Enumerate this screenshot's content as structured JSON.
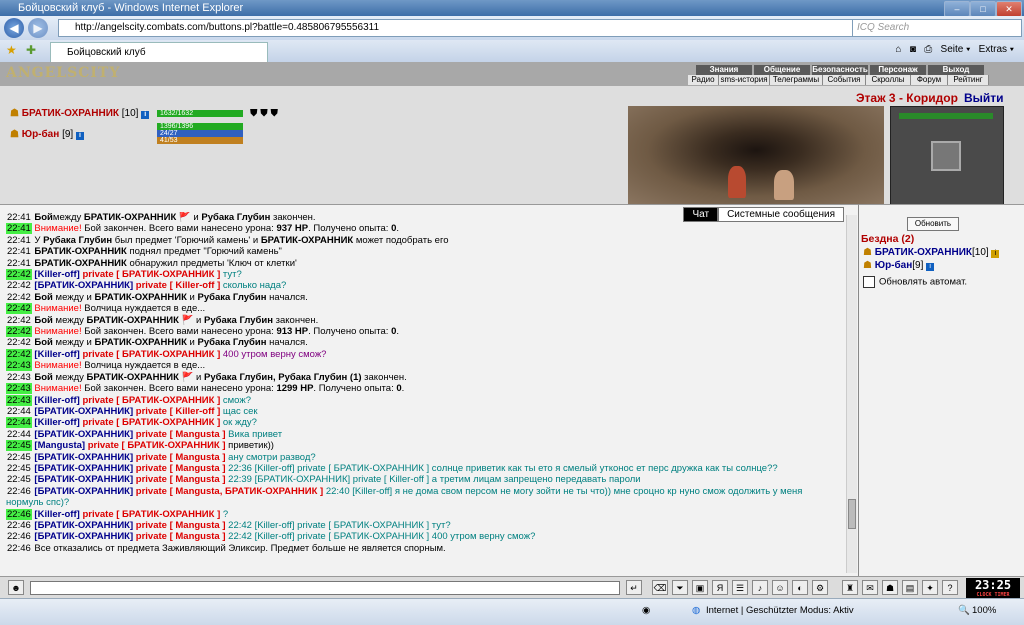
{
  "browser": {
    "title": "Бойцовский клуб - Windows Internet Explorer",
    "url": "http://angelscity.combats.com/buttons.pl?battle=0.485806795556311",
    "search_placeholder": "ICQ Search",
    "tab_title": "Бойцовский клуб",
    "tools": [
      "Seite ▾",
      "Extras ▾"
    ],
    "status_zone": "Internet | Geschützter Modus: Aktiv",
    "zoom": "100%"
  },
  "game": {
    "logo": "ANGELSCITY",
    "menu_top": [
      "Знания",
      "Общение",
      "Безопасность",
      "Персонаж",
      "Выход"
    ],
    "menu_bottom": [
      "Радио",
      "sms-история",
      "Телеграммы",
      "События",
      "Скроллы",
      "Форум",
      "Рейтинг"
    ],
    "floor_label": "Этаж 3 - Коридор",
    "exit_label": "Выйти",
    "players": [
      {
        "name": "БРАТИК-ОХРАННИК",
        "level": "[10]",
        "hp": "1632/1632",
        "hp_fraction": 1.0
      },
      {
        "name": "Юр-бан",
        "level": "[9]",
        "hp": "1396/1396",
        "mana": "24/27",
        "mana_fraction": 0.89,
        "stamina": "41/53",
        "stamina_fraction": 0.77,
        "hp_fraction": 1.0
      }
    ]
  },
  "chat": {
    "tabs": [
      "Чат",
      "Системные сообщения"
    ],
    "rows": [
      {
        "time": "22:41",
        "g": false,
        "segs": [
          [
            "b",
            "Бой"
          ],
          [
            "",
            "между "
          ],
          [
            "b",
            "БРАТИК-ОХРАННИК"
          ],
          [
            "",
            " 🚩 и "
          ],
          [
            "b",
            "Рубака Глубин"
          ],
          [
            "",
            " закончен."
          ]
        ]
      },
      {
        "time": "22:41",
        "g": true,
        "segs": [
          [
            "red",
            "Внимание!"
          ],
          [
            "",
            " Бой закончен. Всего вами нанесено урона: "
          ],
          [
            "b",
            "937 HP"
          ],
          [
            "",
            ". Получено опыта: "
          ],
          [
            "b",
            "0"
          ],
          [
            "",
            "."
          ]
        ]
      },
      {
        "time": "22:41",
        "g": false,
        "segs": [
          [
            "",
            "У "
          ],
          [
            "b",
            "Рубака Глубин"
          ],
          [
            "",
            " был предмет 'Горючий камень' и "
          ],
          [
            "b",
            "БРАТИК-ОХРАННИК"
          ],
          [
            "",
            " может подобрать его"
          ]
        ]
      },
      {
        "time": "22:41",
        "g": false,
        "segs": [
          [
            "b",
            "БРАТИК-ОХРАННИК"
          ],
          [
            "",
            " поднял предмет \"Горючий камень\""
          ]
        ]
      },
      {
        "time": "22:41",
        "g": false,
        "segs": [
          [
            "b",
            "БРАТИК-ОХРАННИК"
          ],
          [
            "",
            " обнаружил предметы 'Ключ от клетки'"
          ]
        ]
      },
      {
        "time": "22:42",
        "g": true,
        "segs": [
          [
            "blu",
            "[Killer-off]"
          ],
          [
            "",
            " "
          ],
          [
            "prv",
            "private [ БРАТИК-ОХРАННИК ]"
          ],
          [
            "teal",
            " тут?"
          ]
        ]
      },
      {
        "time": "22:42",
        "g": false,
        "segs": [
          [
            "blu",
            "[БРАТИК-ОХРАННИК]"
          ],
          [
            "",
            " "
          ],
          [
            "prv",
            "private [ Killer-off ]"
          ],
          [
            "teal",
            " сколько нада?"
          ]
        ]
      },
      {
        "time": "22:42",
        "g": false,
        "segs": [
          [
            "b",
            "Бой"
          ],
          [
            "",
            " между и "
          ],
          [
            "b",
            "БРАТИК-ОХРАННИК"
          ],
          [
            "",
            " и "
          ],
          [
            "b",
            "Рубака Глубин"
          ],
          [
            "",
            " начался."
          ]
        ]
      },
      {
        "time": "22:42",
        "g": true,
        "segs": [
          [
            "red",
            "Внимание!"
          ],
          [
            "",
            " Волчица нуждается в еде..."
          ]
        ]
      },
      {
        "time": "22:42",
        "g": false,
        "segs": [
          [
            "b",
            "Бой"
          ],
          [
            "",
            " между "
          ],
          [
            "b",
            "БРАТИК-ОХРАННИК"
          ],
          [
            "",
            " 🚩 и "
          ],
          [
            "b",
            "Рубака Глубин"
          ],
          [
            "",
            " закончен."
          ]
        ]
      },
      {
        "time": "22:42",
        "g": true,
        "segs": [
          [
            "red",
            "Внимание!"
          ],
          [
            "",
            " Бой закончен. Всего вами нанесено урона: "
          ],
          [
            "b",
            "913 HP"
          ],
          [
            "",
            ". Получено опыта: "
          ],
          [
            "b",
            "0"
          ],
          [
            "",
            "."
          ]
        ]
      },
      {
        "time": "22:42",
        "g": false,
        "segs": [
          [
            "b",
            "Бой"
          ],
          [
            "",
            " между и "
          ],
          [
            "b",
            "БРАТИК-ОХРАННИК"
          ],
          [
            "",
            " и "
          ],
          [
            "b",
            "Рубака Глубин"
          ],
          [
            "",
            " начался."
          ]
        ]
      },
      {
        "time": "22:42",
        "g": true,
        "segs": [
          [
            "blu",
            "[Killer-off]"
          ],
          [
            "",
            " "
          ],
          [
            "prv",
            "private [ БРАТИК-ОХРАННИК ]"
          ],
          [
            "purp",
            " 400 утром верну смож?"
          ]
        ]
      },
      {
        "time": "22:43",
        "g": true,
        "segs": [
          [
            "red",
            "Внимание!"
          ],
          [
            "",
            " Волчица нуждается в еде..."
          ]
        ]
      },
      {
        "time": "22:43",
        "g": false,
        "segs": [
          [
            "b",
            "Бой"
          ],
          [
            "",
            " между "
          ],
          [
            "b",
            "БРАТИК-ОХРАННИК"
          ],
          [
            "",
            " 🚩 и "
          ],
          [
            "b",
            "Рубака Глубин, Рубака Глубин (1)"
          ],
          [
            "",
            " закончен."
          ]
        ]
      },
      {
        "time": "22:43",
        "g": true,
        "segs": [
          [
            "red",
            "Внимание!"
          ],
          [
            "",
            " Бой закончен. Всего вами нанесено урона: "
          ],
          [
            "b",
            "1299 HP"
          ],
          [
            "",
            ". Получено опыта: "
          ],
          [
            "b",
            "0"
          ],
          [
            "",
            "."
          ]
        ]
      },
      {
        "time": "22:43",
        "g": true,
        "segs": [
          [
            "blu",
            "[Killer-off]"
          ],
          [
            "",
            " "
          ],
          [
            "prv",
            "private [ БРАТИК-ОХРАННИК ]"
          ],
          [
            "teal",
            " смож?"
          ]
        ]
      },
      {
        "time": "22:44",
        "g": false,
        "segs": [
          [
            "blu",
            "[БРАТИК-ОХРАННИК]"
          ],
          [
            "",
            " "
          ],
          [
            "prv",
            "private [ Killer-off ]"
          ],
          [
            "teal",
            " щас сек"
          ]
        ]
      },
      {
        "time": "22:44",
        "g": true,
        "segs": [
          [
            "blu",
            "[Killer-off]"
          ],
          [
            "",
            " "
          ],
          [
            "prv",
            "private [ БРАТИК-ОХРАННИК ]"
          ],
          [
            "teal",
            " ок жду?"
          ]
        ]
      },
      {
        "time": "22:44",
        "g": false,
        "segs": [
          [
            "blu",
            "[БРАТИК-ОХРАННИК]"
          ],
          [
            "",
            " "
          ],
          [
            "prv",
            "private [ Mangusta ]"
          ],
          [
            "teal",
            " Вика привет"
          ]
        ]
      },
      {
        "time": "22:45",
        "g": true,
        "segs": [
          [
            "blu",
            "[Mangusta]"
          ],
          [
            "",
            " "
          ],
          [
            "prv",
            "private [ БРАТИК-ОХРАННИК ]"
          ],
          [
            "",
            " приветик))"
          ]
        ]
      },
      {
        "time": "22:45",
        "g": false,
        "segs": [
          [
            "blu",
            "[БРАТИК-ОХРАННИК]"
          ],
          [
            "",
            " "
          ],
          [
            "prv",
            "private [ Mangusta ]"
          ],
          [
            "teal",
            " ану смотри развод?"
          ]
        ]
      },
      {
        "time": "22:45",
        "g": false,
        "segs": [
          [
            "blu",
            "[БРАТИК-ОХРАННИК]"
          ],
          [
            "",
            " "
          ],
          [
            "prv",
            "private [ Mangusta ]"
          ],
          [
            "teal",
            " 22:36 [Killer-off] private [ БРАТИК-ОХРАННИК ] солнце приветик как ты ето я смелый утконос ет перс дружка как ты солнце??"
          ]
        ]
      },
      {
        "time": "22:45",
        "g": false,
        "segs": [
          [
            "blu",
            "[БРАТИК-ОХРАННИК]"
          ],
          [
            "",
            " "
          ],
          [
            "prv",
            "private [ Mangusta ]"
          ],
          [
            "teal",
            " 22:39 [БРАТИК-ОХРАННИК] private [ Killer-off ] а третим лицам запрещено передавать пароли"
          ]
        ]
      },
      {
        "time": "22:46",
        "g": false,
        "segs": [
          [
            "blu",
            "[БРАТИК-ОХРАННИК]"
          ],
          [
            "",
            " "
          ],
          [
            "prv",
            "private [ Mangusta, БРАТИК-ОХРАННИК ]"
          ],
          [
            "teal",
            " 22:40 [Killer-off] я не дома свом персом не могу зойти не ты что)) мне сроцно кр нуно смож одолжить у меня нормуль спс)?"
          ]
        ]
      },
      {
        "time": "22:46",
        "g": true,
        "segs": [
          [
            "blu",
            "[Killer-off]"
          ],
          [
            "",
            " "
          ],
          [
            "prv",
            "private [ БРАТИК-ОХРАННИК ]"
          ],
          [
            "teal",
            " ?"
          ]
        ]
      },
      {
        "time": "22:46",
        "g": false,
        "segs": [
          [
            "blu",
            "[БРАТИК-ОХРАННИК]"
          ],
          [
            "",
            " "
          ],
          [
            "prv",
            "private [ Mangusta ]"
          ],
          [
            "teal",
            " 22:42 [Killer-off] private [ БРАТИК-ОХРАННИК ] тут?"
          ]
        ]
      },
      {
        "time": "22:46",
        "g": false,
        "segs": [
          [
            "blu",
            "[БРАТИК-ОХРАННИК]"
          ],
          [
            "",
            " "
          ],
          [
            "prv",
            "private [ Mangusta ]"
          ],
          [
            "teal",
            " 22:42 [Killer-off] private [ БРАТИК-ОХРАННИК ] 400 утром верну смож?"
          ]
        ]
      },
      {
        "time": "22:46",
        "g": false,
        "segs": [
          [
            "",
            "Все отказались от предмета Заживляющий Эликсир. Предмет больше не является спорным."
          ]
        ]
      }
    ]
  },
  "room": {
    "refresh_label": "Обновить",
    "title": "Бездна (2)",
    "players": [
      {
        "name": "БРАТИК-ОХРАННИК",
        "level": "[10]"
      },
      {
        "name": "Юр-бан",
        "level": "[9]"
      }
    ],
    "auto_refresh_label": "Обновлять автомат."
  },
  "clock": {
    "time": "23:25",
    "label": "CLOCK TIMER"
  },
  "colors": {
    "accent_red": "#b00000",
    "private_red": "#dd0000",
    "nick_blue": "#00008b",
    "time_green": "#44ee44",
    "message_teal": "#008080"
  }
}
